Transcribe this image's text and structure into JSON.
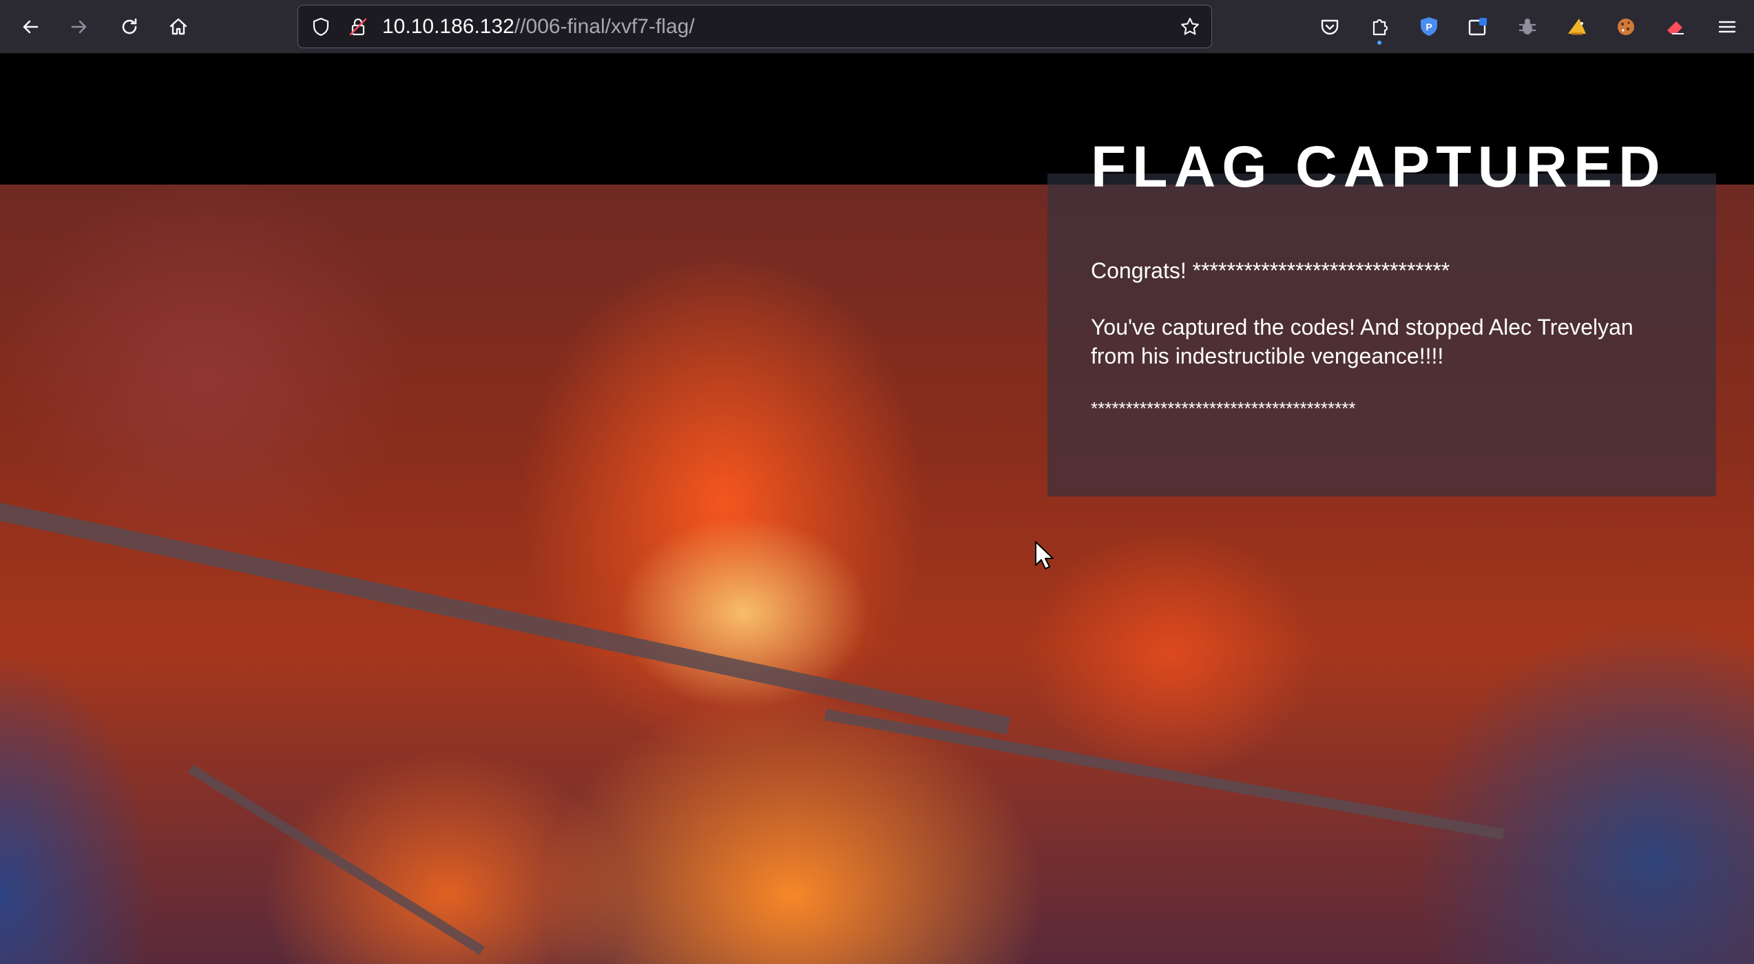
{
  "browser": {
    "url": {
      "host": "10.10.186.132",
      "path": "//006-final/xvf7-flag/"
    },
    "icons": {
      "back": "arrow-left-icon",
      "forward": "arrow-right-icon",
      "reload": "reload-icon",
      "home": "home-icon",
      "shield": "tracking-protection-shield-icon",
      "lock": "insecure-lock-icon",
      "bookmark": "star-icon",
      "pocket": "pocket-icon",
      "extensions": "puzzle-piece-icon",
      "menu": "hamburger-menu-icon"
    },
    "extensions": [
      {
        "name": "shield-p-extension",
        "color": "#4a8df0"
      },
      {
        "name": "container-tab-extension",
        "color": "#ffffff"
      },
      {
        "name": "bug-extension",
        "color": "#8f8f9d"
      },
      {
        "name": "wizard-hat-extension",
        "color": "#f0b429"
      },
      {
        "name": "cookie-extension",
        "color": "#d07a3a"
      },
      {
        "name": "eraser-extension",
        "color": "#ff4d5e"
      }
    ]
  },
  "page": {
    "title": "FLAG CAPTURED",
    "congrats": "Congrats! ******************************",
    "message": "You've captured the codes! And stopped Alec Trevelyan from his indestructible vengeance!!!!",
    "stars": "**************************************"
  },
  "colors": {
    "chrome_bg": "#2b2a33",
    "urlbar_bg": "#1c1b22",
    "panel_bg": "rgba(46,50,66,0.62)",
    "text": "#ffffff"
  }
}
